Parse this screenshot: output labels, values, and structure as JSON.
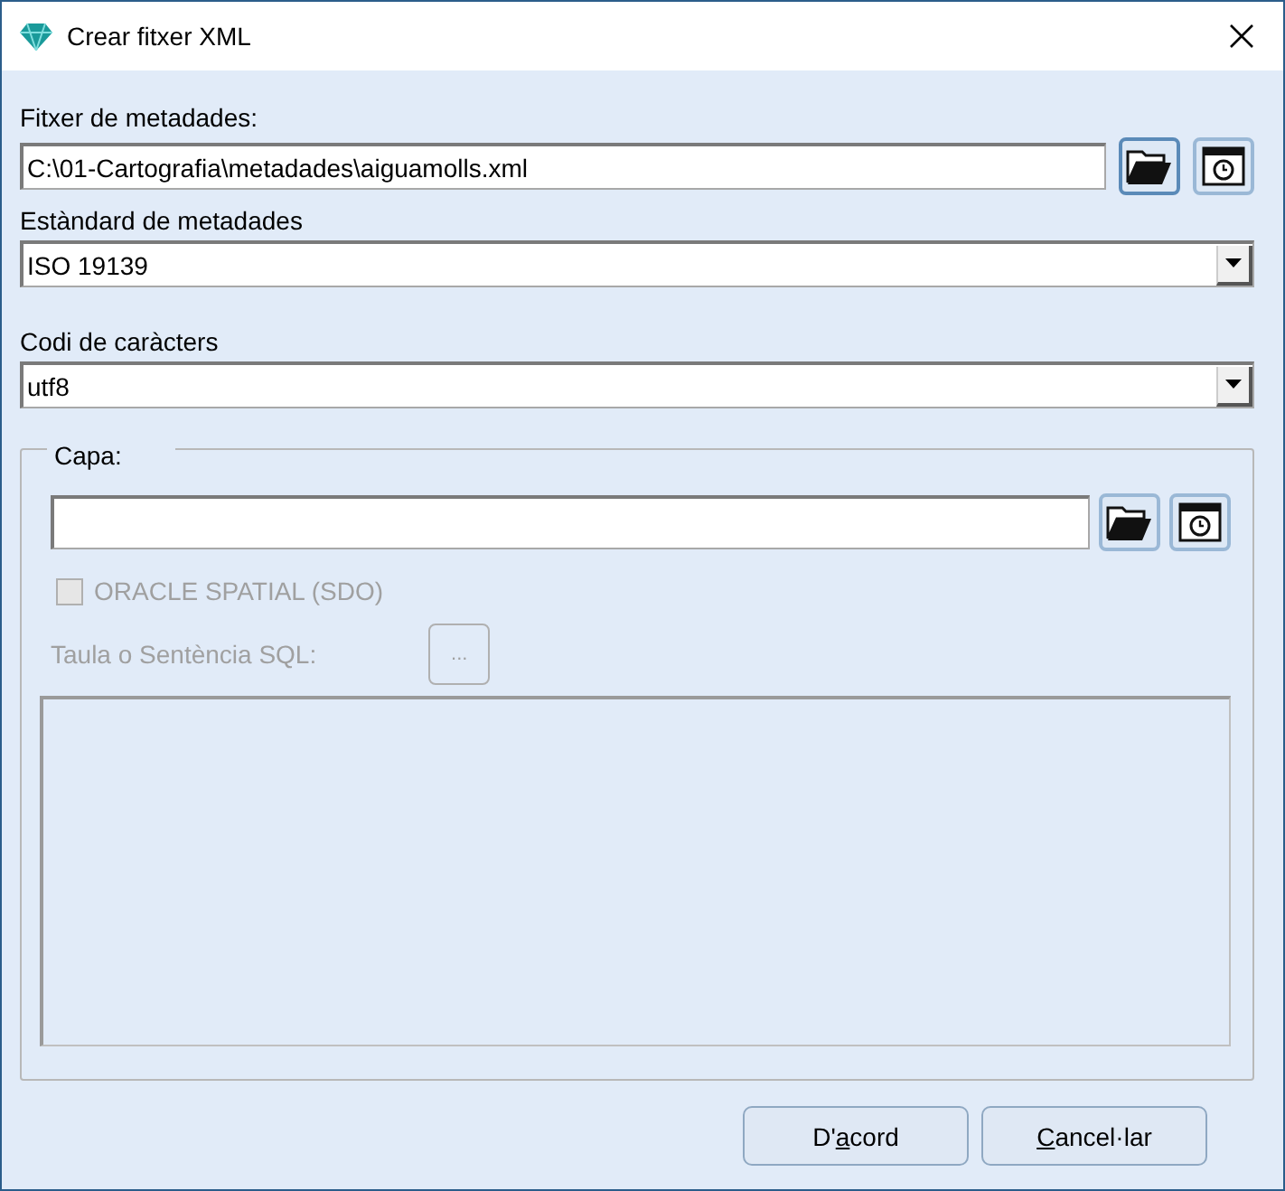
{
  "window": {
    "title": "Crear fitxer XML"
  },
  "metadata_file": {
    "label": "Fitxer de metadades:",
    "value": "C:\\01-Cartografia\\metadades\\aiguamolls.xml"
  },
  "standard": {
    "label": "Estàndard de metadades",
    "value": "ISO 19139"
  },
  "encoding": {
    "label": "Codi de caràcters",
    "value": "utf8"
  },
  "layer_group": {
    "label": "Capa:",
    "oracle_checkbox": {
      "label": "ORACLE SPATIAL (SDO)",
      "checked": false,
      "disabled": true
    },
    "sql": {
      "label": "Taula o Sentència SQL:",
      "button": "...",
      "disabled": true
    }
  },
  "buttons": [
    {
      "label_parts": [
        {
          "text": "D'",
          "underlined": false
        },
        {
          "text": "a",
          "underlined": true
        },
        {
          "text": "cord",
          "underlined": false
        }
      ]
    },
    {
      "label_parts": [
        {
          "text": "C",
          "underlined": true
        },
        {
          "text": "ancel·lar",
          "underlined": false
        }
      ]
    }
  ]
}
